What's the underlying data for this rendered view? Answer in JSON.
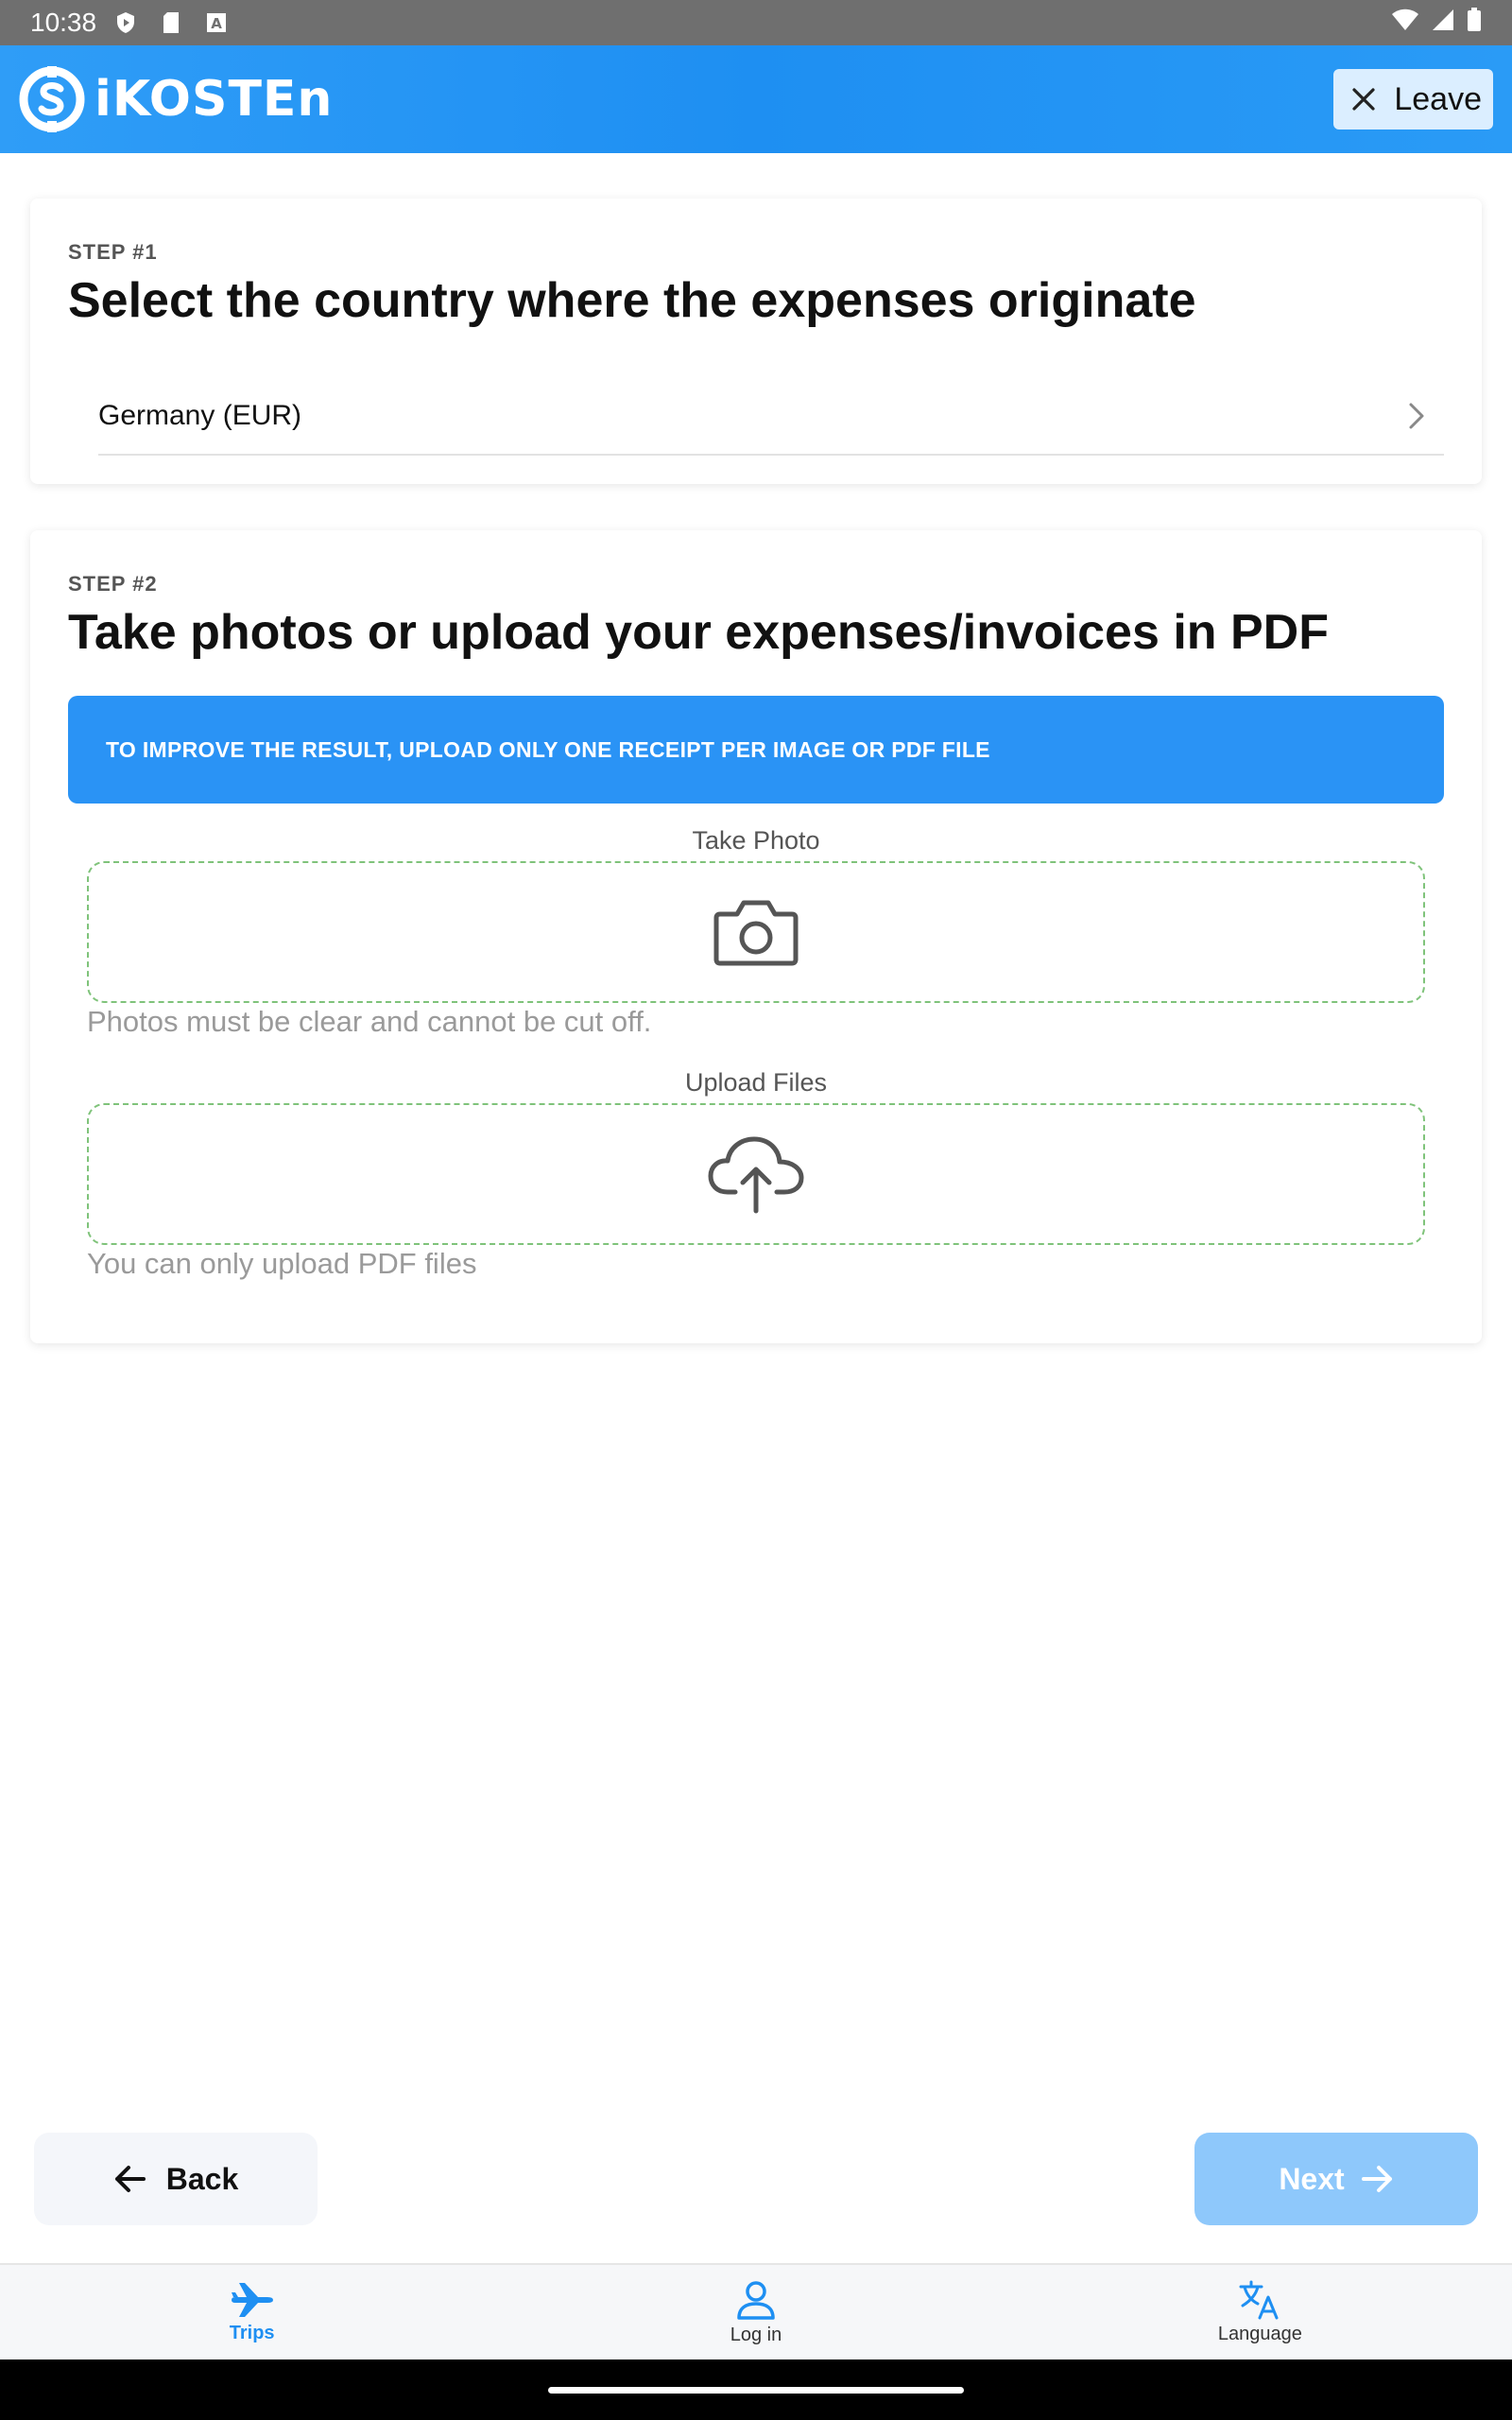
{
  "status_bar": {
    "time": "10:38"
  },
  "header": {
    "logo_text": "iKOSTEn",
    "leave_label": "Leave"
  },
  "step1": {
    "label": "STEP #1",
    "title": "Select the country where the expenses originate",
    "country_value": "Germany (EUR)"
  },
  "step2": {
    "label": "STEP #2",
    "title": "Take photos or upload your expenses/invoices in PDF",
    "banner": "TO IMPROVE THE RESULT, UPLOAD ONLY ONE RECEIPT PER IMAGE OR PDF FILE",
    "take_photo_label": "Take Photo",
    "take_photo_hint": "Photos must be clear and cannot be cut off.",
    "upload_label": "Upload Files",
    "upload_hint": "You can only upload PDF files"
  },
  "actions": {
    "back_label": "Back",
    "next_label": "Next"
  },
  "bottom_nav": {
    "items": [
      {
        "label": "Trips",
        "icon": "airplane-icon",
        "active": true
      },
      {
        "label": "Log in",
        "icon": "person-icon",
        "active": false
      },
      {
        "label": "Language",
        "icon": "translate-icon",
        "active": false
      }
    ]
  },
  "colors": {
    "brand": "#1e8ff2",
    "banner": "#2a93f5",
    "next_disabled": "#8ec8fb",
    "dropzone_border": "#7fc37a"
  }
}
